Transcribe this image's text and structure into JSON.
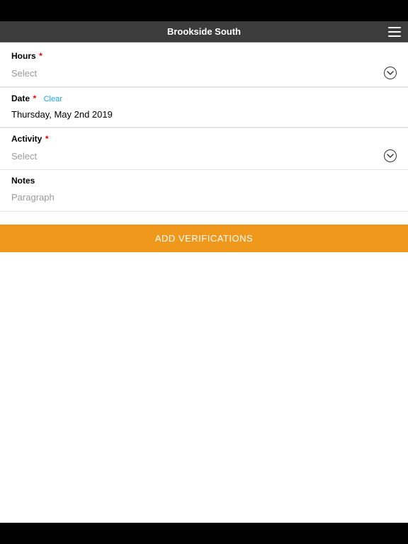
{
  "header": {
    "title": "Brookside South"
  },
  "form": {
    "hours": {
      "label": "Hours",
      "required": "*",
      "placeholder": "Select"
    },
    "date": {
      "label": "Date",
      "required": "*",
      "clear": "Clear",
      "value": "Thursday, May 2nd 2019"
    },
    "activity": {
      "label": "Activity",
      "required": "*",
      "placeholder": "Select"
    },
    "notes": {
      "label": "Notes",
      "placeholder": "Paragraph"
    }
  },
  "button": {
    "add_verifications": "ADD VERIFICATIONS"
  }
}
